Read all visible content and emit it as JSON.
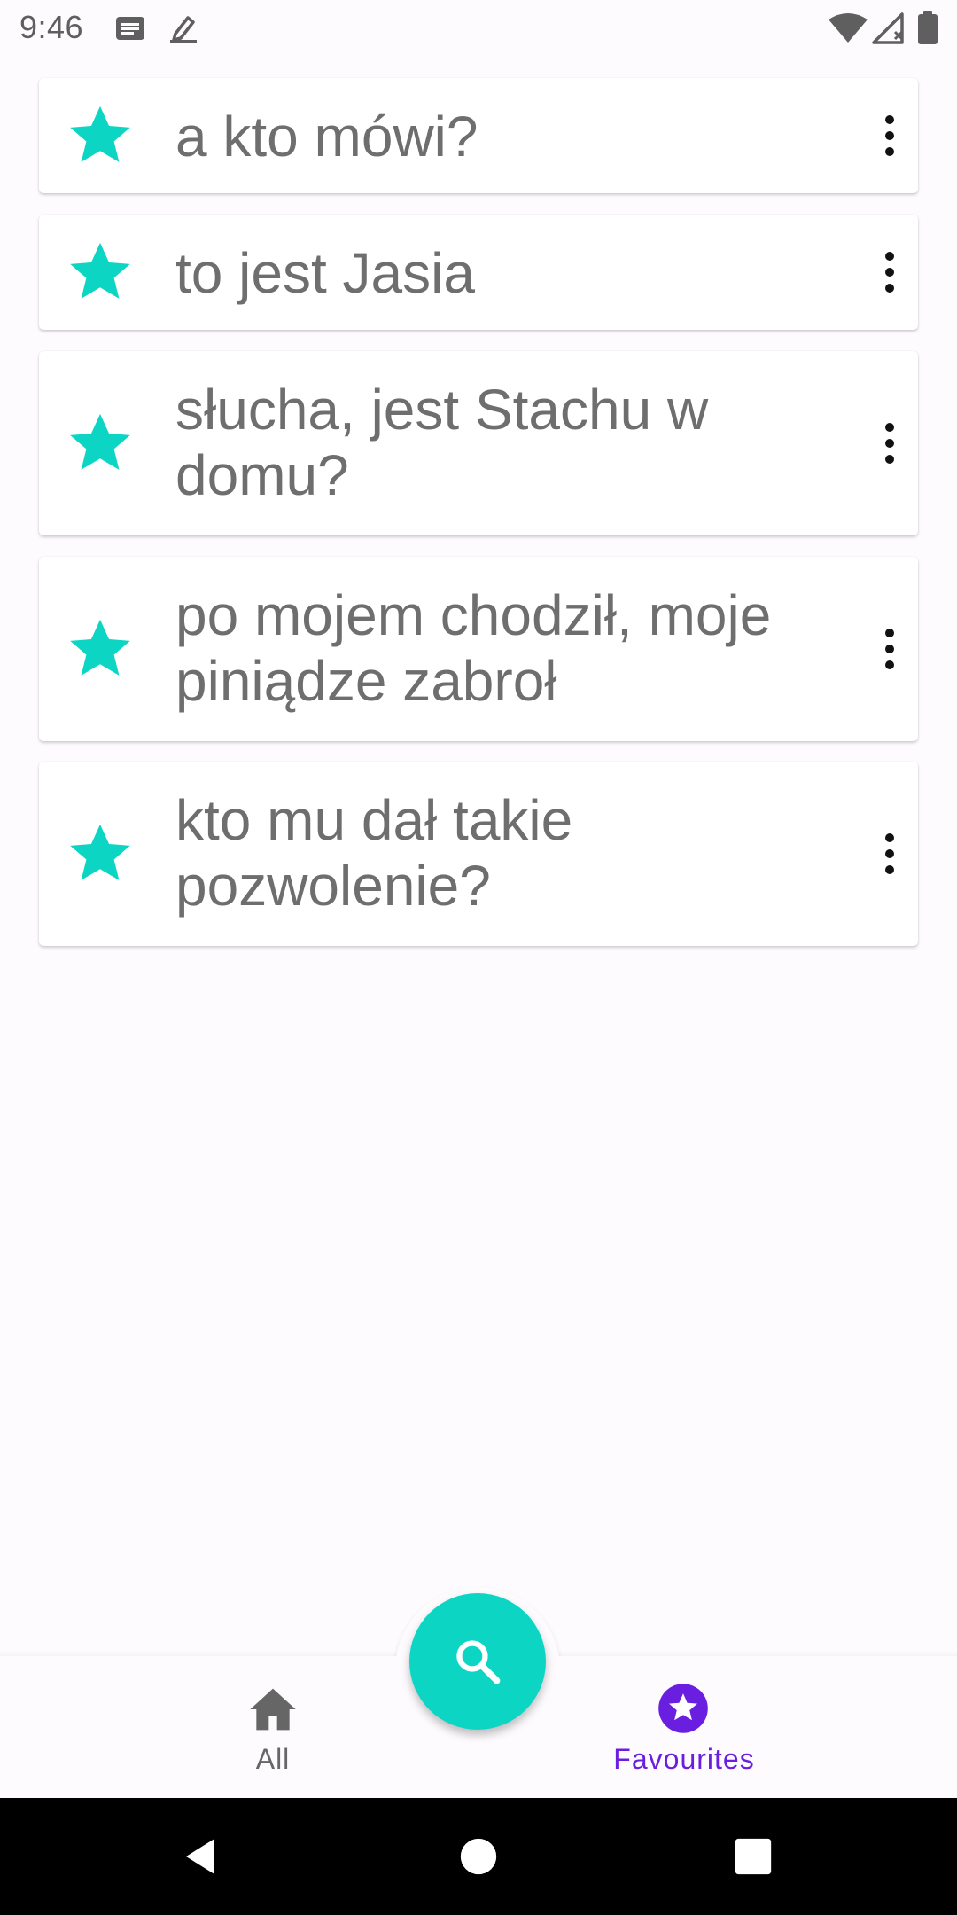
{
  "status_bar": {
    "time": "9:46",
    "icons": [
      "message-icon",
      "edit-note-icon",
      "wifi-icon",
      "signal-icon",
      "battery-icon"
    ]
  },
  "phrases": [
    {
      "text": "a kto mówi?"
    },
    {
      "text": "to jest Jasia"
    },
    {
      "text": "słucha, jest Stachu w domu?"
    },
    {
      "text": "po mojem chodził, moje piniądze zabroł"
    },
    {
      "text": "kto mu dał takie pozwolenie?"
    }
  ],
  "fab": {
    "icon": "search-icon"
  },
  "bottom_nav": {
    "all_label": "All",
    "favourites_label": "Favourites"
  },
  "colors": {
    "accent": "#0cd6c3",
    "nav_active": "#6a1fe0",
    "nav_inactive": "#666666",
    "text": "#6e6e6e"
  }
}
